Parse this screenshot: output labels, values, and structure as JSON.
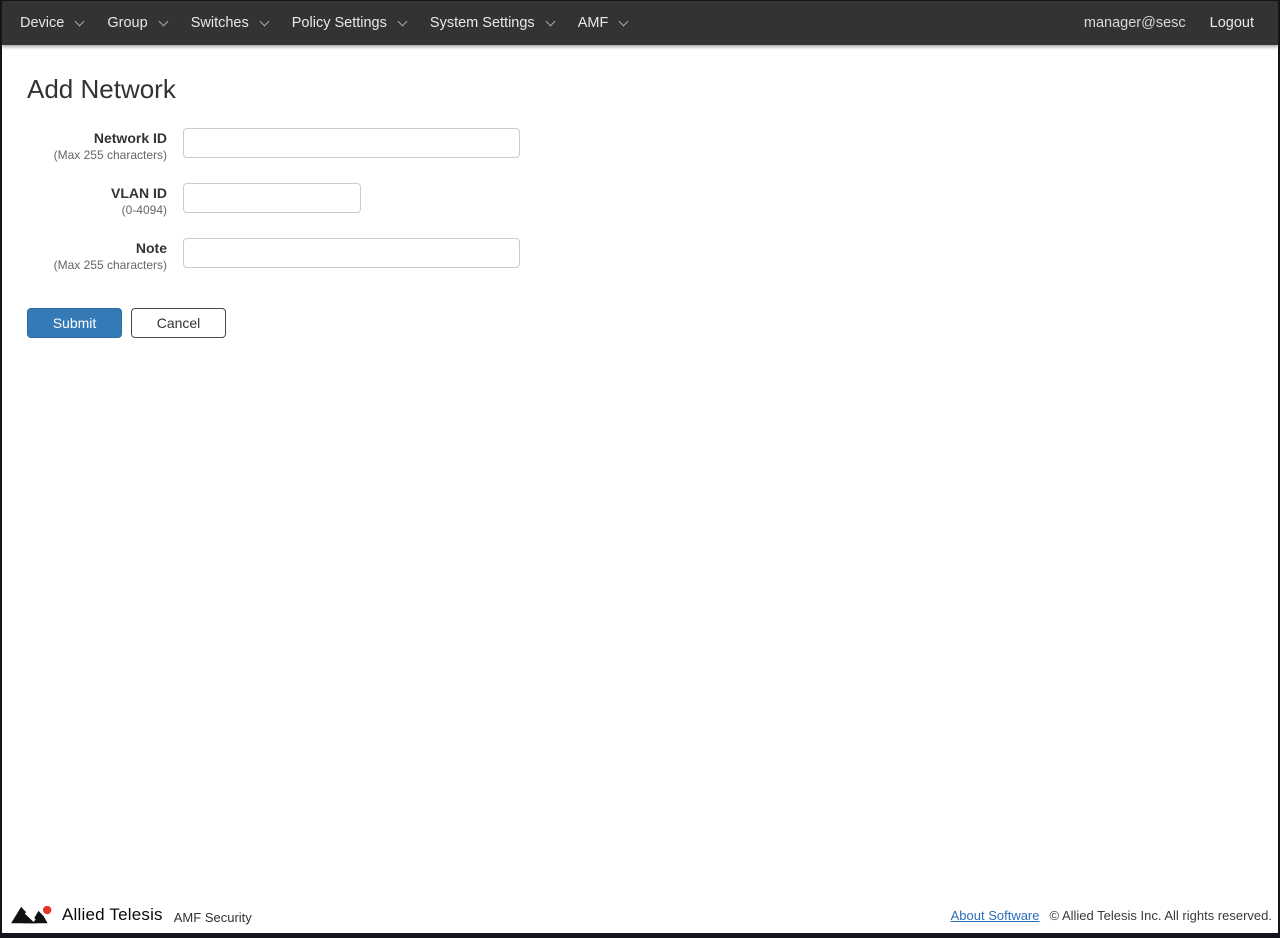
{
  "navbar": {
    "items": [
      {
        "label": "Device"
      },
      {
        "label": "Group"
      },
      {
        "label": "Switches"
      },
      {
        "label": "Policy Settings"
      },
      {
        "label": "System Settings"
      },
      {
        "label": "AMF"
      }
    ],
    "user": "manager@sesc",
    "logout_label": "Logout"
  },
  "page": {
    "title": "Add Network"
  },
  "form": {
    "fields": [
      {
        "label": "Network ID",
        "hint": "(Max 255 characters)",
        "value": ""
      },
      {
        "label": "VLAN ID",
        "hint": "(0-4094)",
        "value": ""
      },
      {
        "label": "Note",
        "hint": "(Max 255 characters)",
        "value": ""
      }
    ],
    "submit_label": "Submit",
    "cancel_label": "Cancel"
  },
  "footer": {
    "brand": "Allied Telesis",
    "product": "AMF Security",
    "about_link": "About Software",
    "copyright": "© Allied Telesis Inc. All rights reserved."
  },
  "colors": {
    "navbar_bg": "#333333",
    "primary_button": "#337ab7",
    "link_blue": "#2a6ebb",
    "logo_red": "#e6332a"
  }
}
